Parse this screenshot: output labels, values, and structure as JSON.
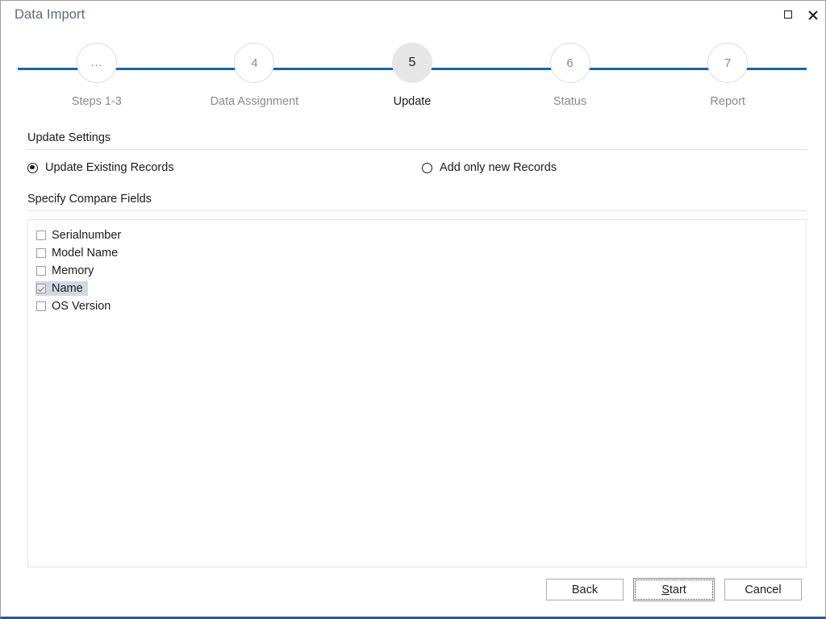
{
  "window": {
    "title": "Data Import",
    "controls": [
      {
        "name": "restore-button",
        "label": "Restore"
      },
      {
        "name": "close-button",
        "label": "Close"
      }
    ],
    "accent_color": "#2a5699"
  },
  "stepper": {
    "line_color": "#1466b0",
    "active_circle_color": "#e6e6e6",
    "steps": [
      {
        "number": "...",
        "label": "Steps 1-3",
        "active": false
      },
      {
        "number": "4",
        "label": "Data Assignment",
        "active": false
      },
      {
        "number": "5",
        "label": "Update",
        "active": true
      },
      {
        "number": "6",
        "label": "Status",
        "active": false
      },
      {
        "number": "7",
        "label": "Report",
        "active": false
      }
    ]
  },
  "update_settings": {
    "heading": "Update Settings",
    "options": [
      {
        "label": "Update Existing Records",
        "selected": true
      },
      {
        "label": "Add only new Records",
        "selected": false
      }
    ]
  },
  "compare_fields": {
    "heading": "Specify Compare Fields",
    "items": [
      {
        "label": "Serialnumber",
        "checked": false,
        "selected": false
      },
      {
        "label": "Model Name",
        "checked": false,
        "selected": false
      },
      {
        "label": "Memory",
        "checked": false,
        "selected": false
      },
      {
        "label": "Name",
        "checked": true,
        "selected": true
      },
      {
        "label": "OS Version",
        "checked": false,
        "selected": false
      }
    ],
    "selection_color": "#cfd8e3"
  },
  "footer": {
    "back_label": "Back",
    "start_label": "Start",
    "start_accel": "S",
    "start_rest": "tart",
    "cancel_label": "Cancel"
  }
}
